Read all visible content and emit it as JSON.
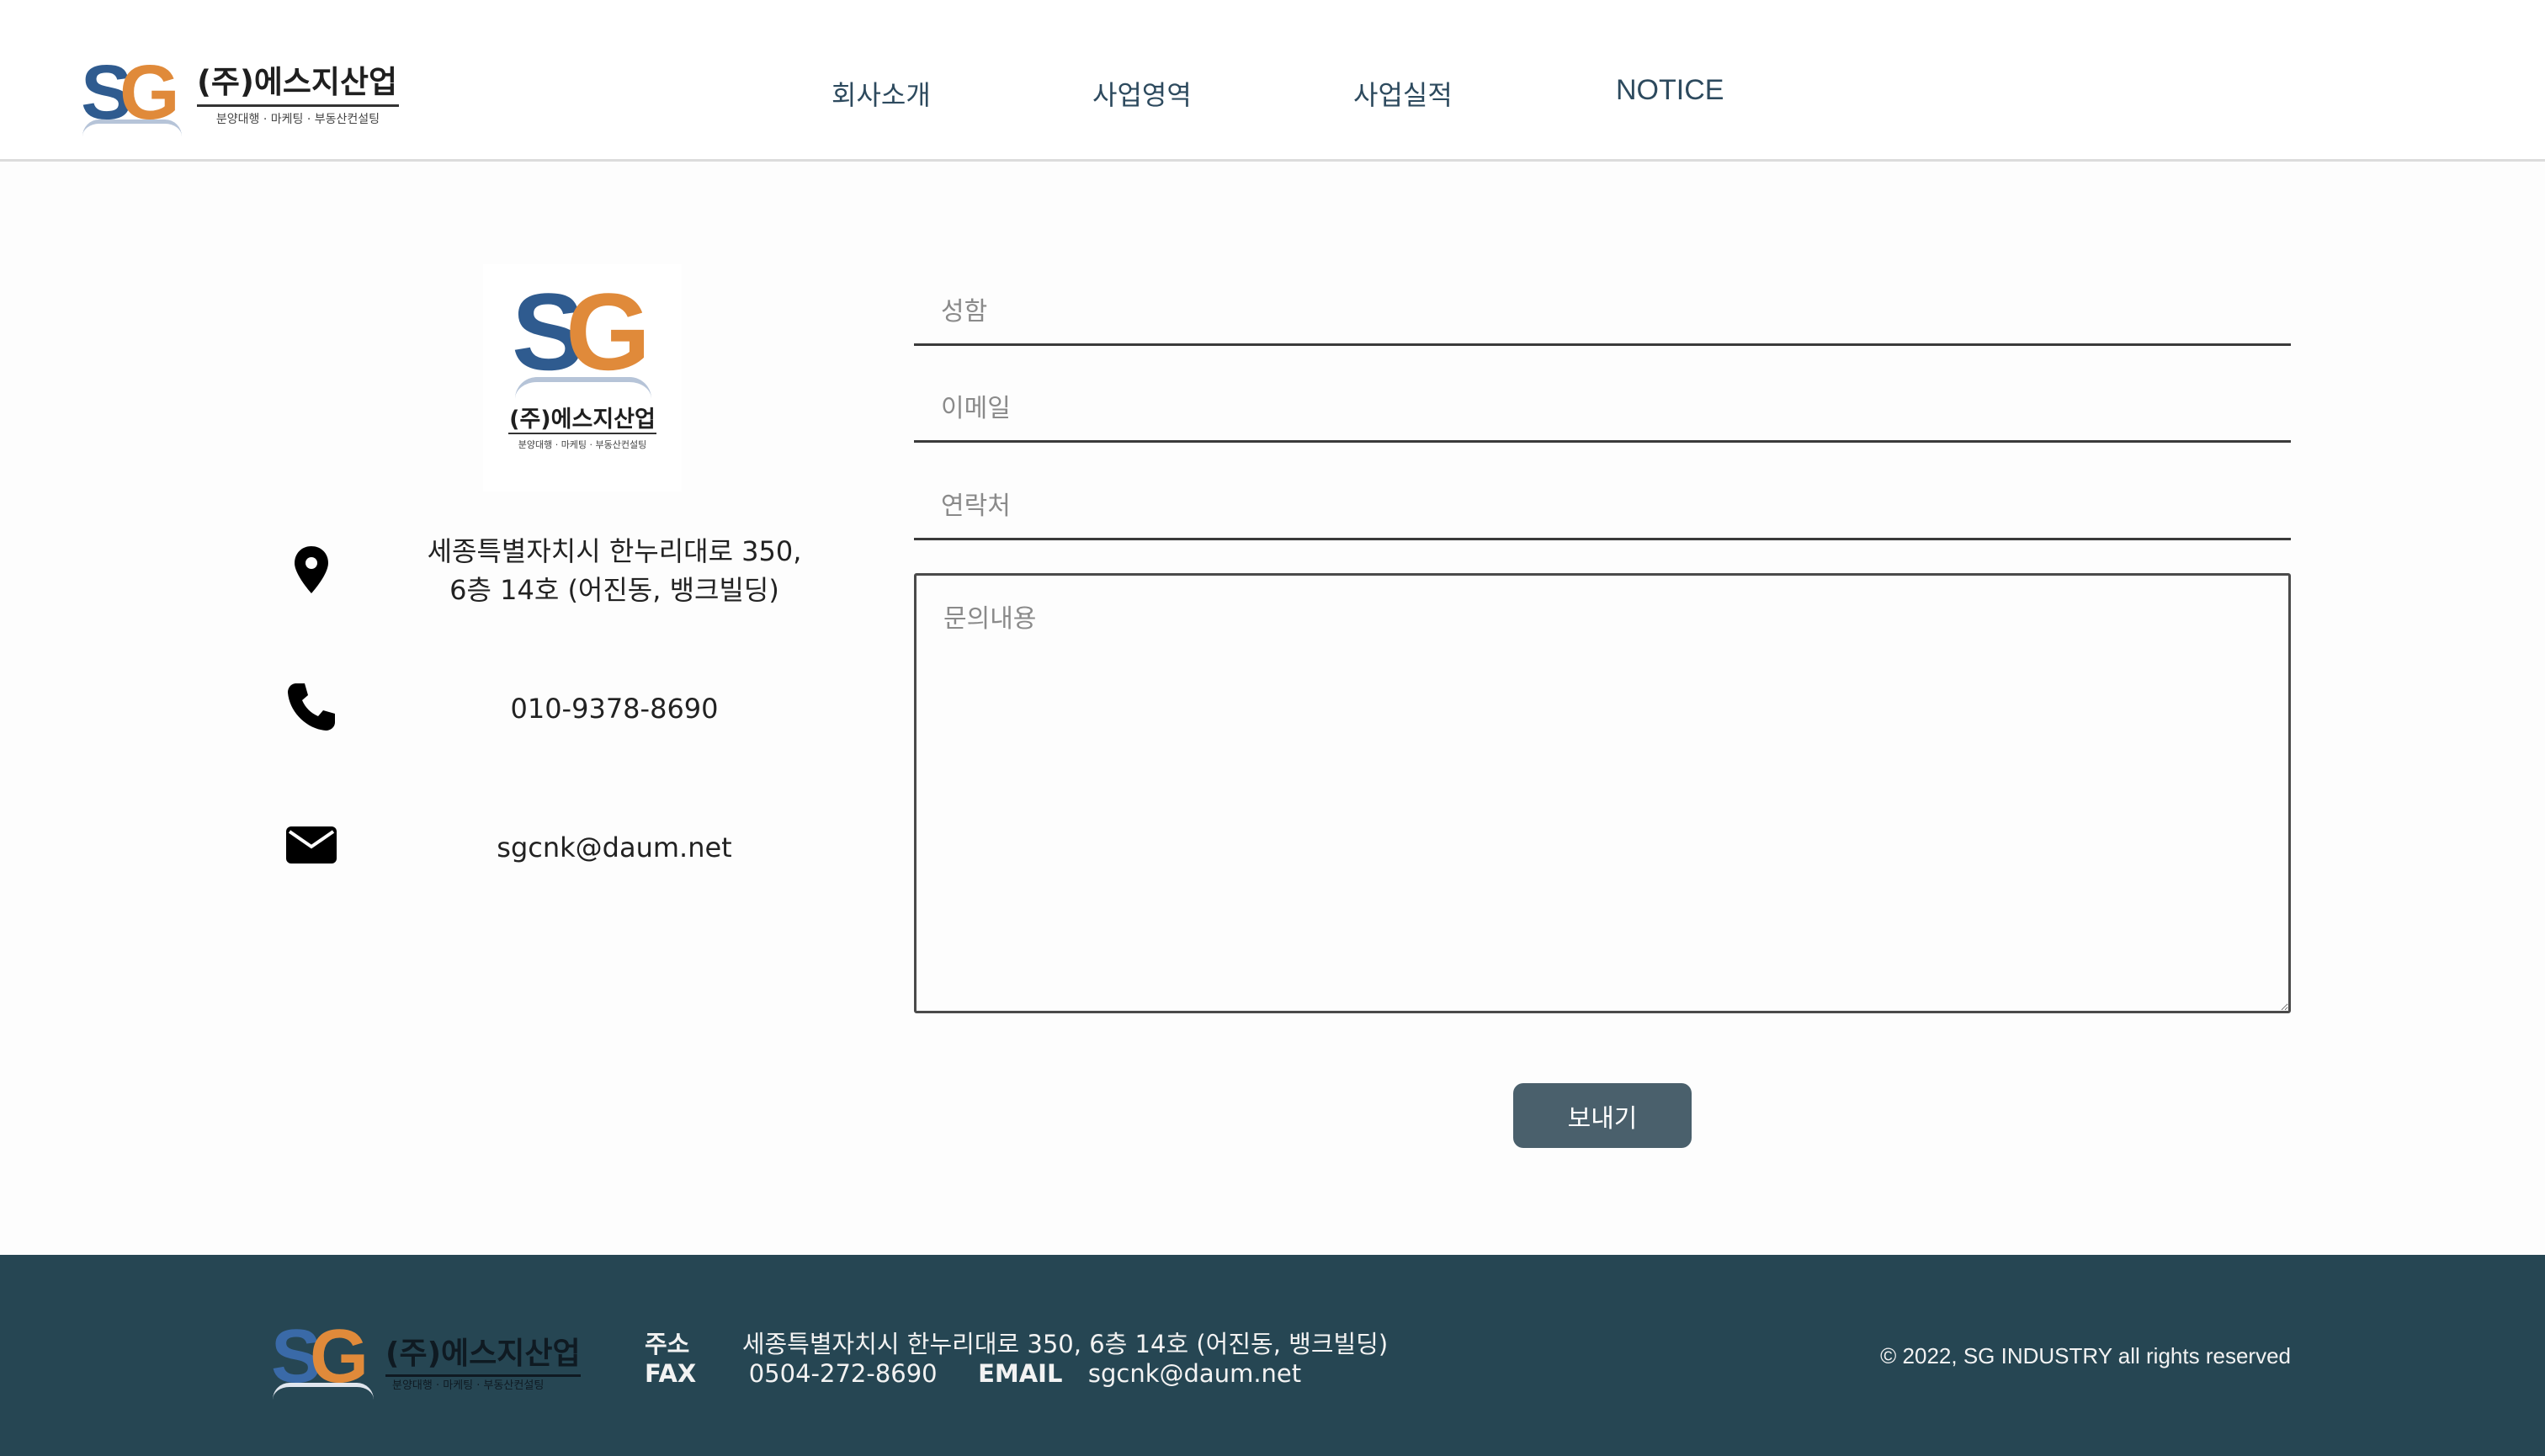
{
  "header": {
    "logo": {
      "mark_letters": [
        "S",
        "G"
      ],
      "company_name": "(주)에스지산업",
      "tagline": "분양대행 · 마케팅 · 부동산컨설팅"
    },
    "nav": [
      {
        "label": "회사소개"
      },
      {
        "label": "사업영역"
      },
      {
        "label": "사업실적"
      },
      {
        "label": "NOTICE"
      }
    ]
  },
  "contact": {
    "logo": {
      "mark_letters": [
        "S",
        "G"
      ],
      "company_name": "(주)에스지산업",
      "tagline": "분양대행 · 마케팅 · 부동산컨설팅"
    },
    "address_line1": "세종특별자치시 한누리대로 350,",
    "address_line2": "6층 14호 (어진동, 뱅크빌딩)",
    "phone": "010-9378-8690",
    "email": "sgcnk@daum.net",
    "icons": [
      "map-pin-icon",
      "phone-icon",
      "envelope-icon"
    ]
  },
  "form": {
    "name_placeholder": "성함",
    "email_placeholder": "이메일",
    "phone_placeholder": "연락처",
    "message_placeholder": "문의내용",
    "submit_label": "보내기"
  },
  "footer": {
    "logo": {
      "mark_letters": [
        "S",
        "G"
      ],
      "company_name": "(주)에스지산업",
      "tagline": "분양대행 · 마케팅 · 부동산컨설팅"
    },
    "address_label": "주소",
    "address": "세종특별자치시 한누리대로 350, 6층 14호 (어진동, 뱅크빌딩)",
    "fax_label": "FAX",
    "fax": "0504-272-8690",
    "email_label": "EMAIL",
    "email": "sgcnk@daum.net",
    "copyright": "© 2022, SG INDUSTRY all rights reserved"
  },
  "colors": {
    "footer_bg": "#264653",
    "button_bg": "#4a606c",
    "nav_text": "#2d4a5e",
    "logo_blue": "#2f5b8f",
    "logo_orange": "#e08a3a"
  }
}
